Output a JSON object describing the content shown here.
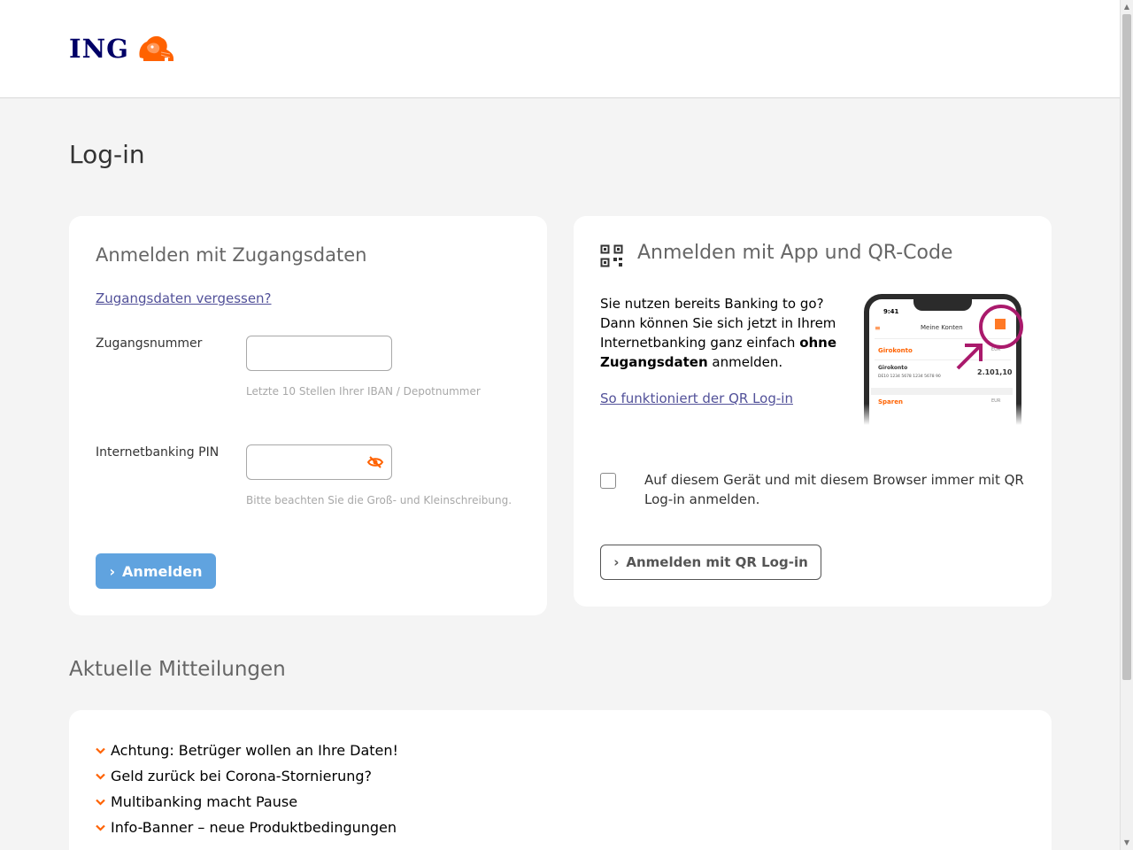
{
  "brand": {
    "name": "ING",
    "accent": "#ff6200",
    "navy": "#000066"
  },
  "page": {
    "title": "Log-in"
  },
  "credentials": {
    "heading": "Anmelden mit Zugangsdaten",
    "forgot_link": "Zugangsdaten vergessen?",
    "account_label": "Zugangsnummer",
    "account_value": "",
    "account_hint": "Letzte 10 Stellen Ihrer IBAN / Depotnummer",
    "pin_label": "Internetbanking PIN",
    "pin_value": "",
    "pin_hint": "Bitte beachten Sie die Groß- und Kleinschreibung.",
    "submit_label": "Anmelden",
    "button_color": "#60a3df"
  },
  "qr": {
    "heading": "Anmelden mit App und QR-Code",
    "text_1": "Sie nutzen bereits Banking to go? Dann können Sie sich jetzt in Ihrem Internetbanking ganz einfach ",
    "text_bold": "ohne Zugangsdaten",
    "text_2": " anmelden.",
    "how_link": "So funktioniert der QR Log-in",
    "remember_label": "Auf diesem Gerät und mit diesem Browser immer mit QR Log-in anmelden.",
    "submit_label": "Anmelden mit QR Log-in",
    "phone": {
      "time": "9:41",
      "title": "Meine Konten",
      "row1": "Girokonto",
      "row1_amount": "EUR",
      "row2": "Girokonto",
      "row2_iban": "DE10 1234 5678 1234 5678 90",
      "row2_amount": "2.101,10",
      "row3": "Sparen",
      "row3_amount": "EUR"
    }
  },
  "news": {
    "title": "Aktuelle Mitteilungen",
    "items": [
      "Achtung: Betrüger wollen an Ihre Daten!",
      "Geld zurück bei Corona-Stornierung?",
      "Multibanking macht Pause",
      "Info-Banner – neue Produktbedingungen"
    ]
  }
}
